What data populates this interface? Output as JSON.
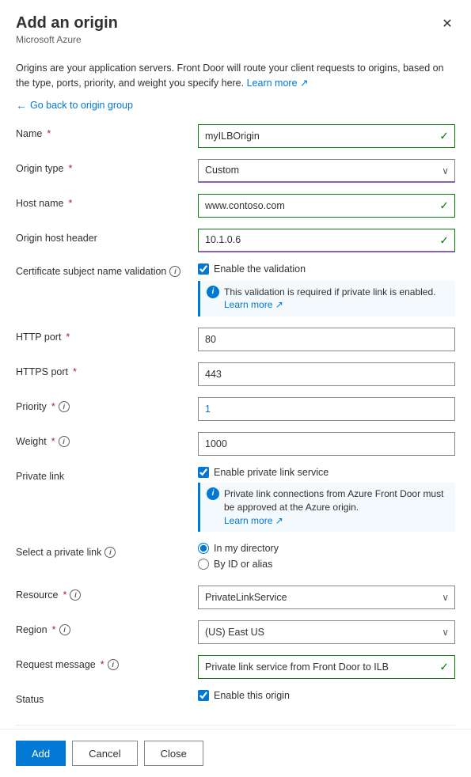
{
  "header": {
    "title": "Add an origin",
    "subtitle": "Microsoft Azure"
  },
  "description": {
    "text": "Origins are your application servers. Front Door will route your client requests to origins, based on the type, ports, priority, and weight you specify here.",
    "learn_more": "Learn more"
  },
  "back_link": "Go back to origin group",
  "form": {
    "name_label": "Name",
    "name_value": "myILBOrigin",
    "origin_type_label": "Origin type",
    "origin_type_value": "Custom",
    "host_name_label": "Host name",
    "host_name_value": "www.contoso.com",
    "origin_host_header_label": "Origin host header",
    "origin_host_header_value": "10.1.0.6",
    "cert_label": "Certificate subject name validation",
    "cert_checkbox_label": "Enable the validation",
    "cert_info": "This validation is required if private link is enabled.",
    "cert_learn_more": "Learn more",
    "http_port_label": "HTTP port",
    "http_port_value": "80",
    "https_port_label": "HTTPS port",
    "https_port_value": "443",
    "priority_label": "Priority",
    "priority_value": "1",
    "weight_label": "Weight",
    "weight_value": "1000",
    "private_link_label": "Private link",
    "private_link_checkbox_label": "Enable private link service",
    "private_link_info": "Private link connections from Azure Front Door must be approved at the Azure origin.",
    "private_link_learn_more": "Learn more",
    "select_private_link_label": "Select a private link",
    "radio_in_directory": "In my directory",
    "radio_by_id": "By ID or alias",
    "resource_label": "Resource",
    "resource_value": "PrivateLinkService",
    "region_label": "Region",
    "region_value": "(US) East US",
    "request_message_label": "Request message",
    "request_message_value": "Private link service from Front Door to ILB",
    "status_label": "Status",
    "status_checkbox_label": "Enable this origin"
  },
  "footer": {
    "add_label": "Add",
    "cancel_label": "Cancel",
    "close_label": "Close"
  },
  "icons": {
    "close": "✕",
    "back_arrow": "←",
    "check": "✓",
    "dropdown_arrow": "⌄",
    "info": "i",
    "ext_link": "↗"
  }
}
